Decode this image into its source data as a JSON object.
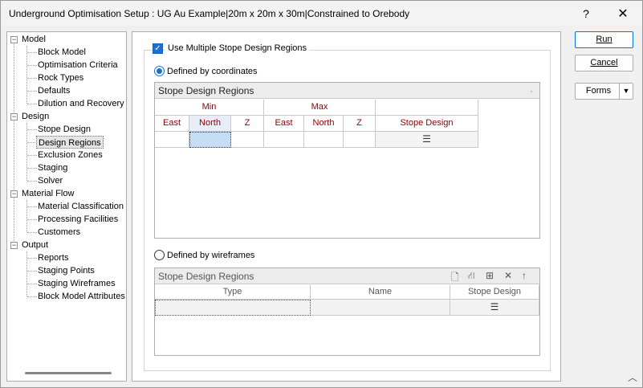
{
  "window": {
    "title": "Underground Optimisation Setup : UG Au Example|20m x 20m x 30m|Constrained to Orebody",
    "help_glyph": "?",
    "close_glyph": "✕"
  },
  "tree": {
    "groups": [
      {
        "label": "Model",
        "items": [
          "Block Model",
          "Optimisation Criteria",
          "Rock Types",
          "Defaults",
          "Dilution and Recovery"
        ]
      },
      {
        "label": "Design",
        "items": [
          "Stope Design",
          "Design Regions",
          "Exclusion Zones",
          "Staging",
          "Solver"
        ]
      },
      {
        "label": "Material Flow",
        "items": [
          "Material Classification",
          "Processing Facilities",
          "Customers"
        ]
      },
      {
        "label": "Output",
        "items": [
          "Reports",
          "Staging Points",
          "Staging Wireframes",
          "Block Model Attributes"
        ]
      }
    ],
    "selected": "Design Regions"
  },
  "main": {
    "use_multiple_label": "Use Multiple Stope Design Regions",
    "use_multiple_checked": true,
    "by_coordinates_label": "Defined by coordinates",
    "by_wireframes_label": "Defined by wireframes",
    "coord_grid": {
      "title": "Stope Design Regions",
      "title_dot": "·",
      "group_min": "Min",
      "group_max": "Max",
      "columns": [
        "East",
        "North",
        "Z",
        "East",
        "North",
        "Z",
        "Stope Design"
      ],
      "menu_glyph": "☰"
    },
    "wire_grid": {
      "title": "Stope Design Regions",
      "columns": [
        "Type",
        "Name",
        "Stope Design"
      ],
      "menu_glyph": "☰"
    }
  },
  "buttons": {
    "run": "Run",
    "cancel": "Cancel",
    "forms": "Forms"
  }
}
